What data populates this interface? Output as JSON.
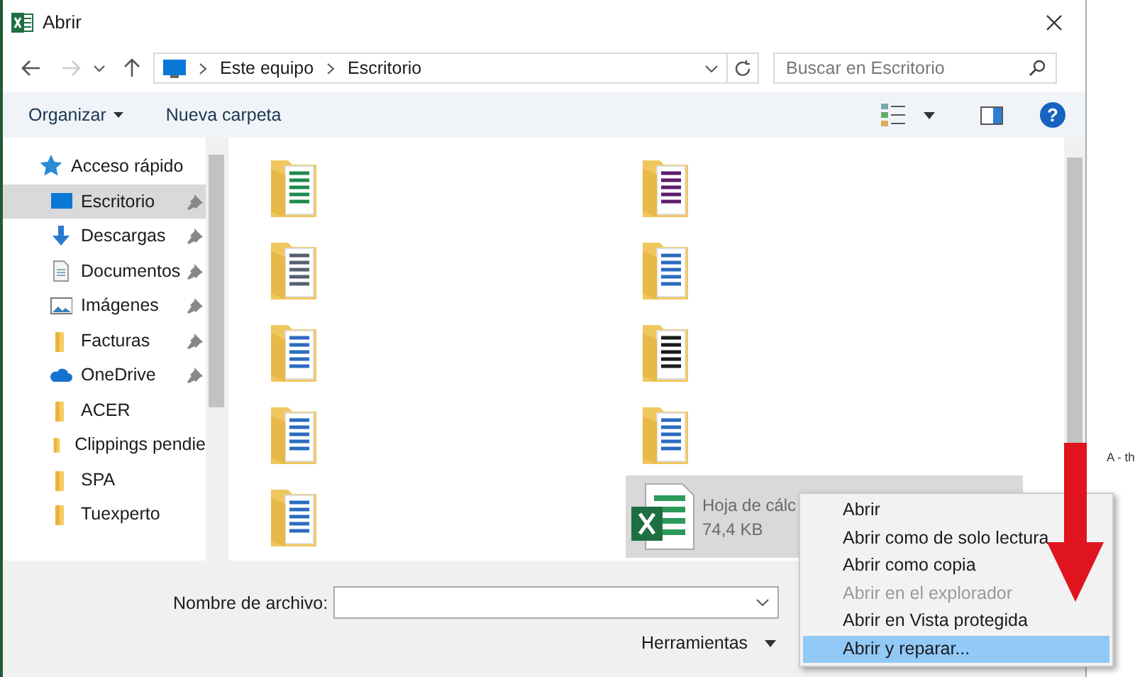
{
  "window": {
    "title": "Abrir"
  },
  "address": {
    "path": [
      {
        "label": "Este equipo"
      },
      {
        "label": "Escritorio"
      }
    ]
  },
  "search": {
    "placeholder": "Buscar en Escritorio"
  },
  "toolbar": {
    "organize": "Organizar",
    "new_folder": "Nueva carpeta",
    "help": "?"
  },
  "sidebar": {
    "items": [
      {
        "label": "Acceso rápido",
        "kind": "star",
        "pinned": false,
        "selected": false
      },
      {
        "label": "Escritorio",
        "kind": "desktop",
        "pinned": true,
        "selected": true
      },
      {
        "label": "Descargas",
        "kind": "download",
        "pinned": true,
        "selected": false
      },
      {
        "label": "Documentos",
        "kind": "document",
        "pinned": true,
        "selected": false
      },
      {
        "label": "Imágenes",
        "kind": "pictures",
        "pinned": true,
        "selected": false
      },
      {
        "label": "Facturas",
        "kind": "folder",
        "pinned": true,
        "selected": false
      },
      {
        "label": "OneDrive",
        "kind": "cloud",
        "pinned": true,
        "selected": false
      },
      {
        "label": "ACER",
        "kind": "folder",
        "pinned": false,
        "selected": false
      },
      {
        "label": "Clippings pendie",
        "kind": "folder",
        "pinned": false,
        "selected": false
      },
      {
        "label": "SPA",
        "kind": "folder",
        "pinned": false,
        "selected": false
      },
      {
        "label": "Tuexperto",
        "kind": "folder",
        "pinned": false,
        "selected": false
      }
    ]
  },
  "files": [
    {
      "kind": "folder",
      "selected": false
    },
    {
      "kind": "folder",
      "selected": false
    },
    {
      "kind": "folder",
      "selected": false
    },
    {
      "kind": "folder",
      "selected": false
    },
    {
      "kind": "folder",
      "selected": false
    },
    {
      "kind": "folder",
      "selected": false
    },
    {
      "kind": "folder",
      "selected": false
    },
    {
      "kind": "folder",
      "selected": false
    },
    {
      "kind": "folder",
      "selected": false
    },
    {
      "kind": "spreadsheet",
      "selected": true,
      "name": "Hoja de cálc",
      "size": "74,4 KB"
    }
  ],
  "bottom": {
    "filename_label": "Nombre de archivo:",
    "tools": "Herramientas"
  },
  "context_menu": [
    {
      "label": "Abrir",
      "disabled": false,
      "selected": false
    },
    {
      "label": "Abrir como de solo lectura",
      "disabled": false,
      "selected": false
    },
    {
      "label": "Abrir como copia",
      "disabled": false,
      "selected": false
    },
    {
      "label": "Abrir en el explorador",
      "disabled": true,
      "selected": false
    },
    {
      "label": "Abrir en Vista protegida",
      "disabled": false,
      "selected": false
    },
    {
      "label": "Abrir y reparar...",
      "disabled": false,
      "selected": true
    }
  ],
  "background_text": "A - th"
}
